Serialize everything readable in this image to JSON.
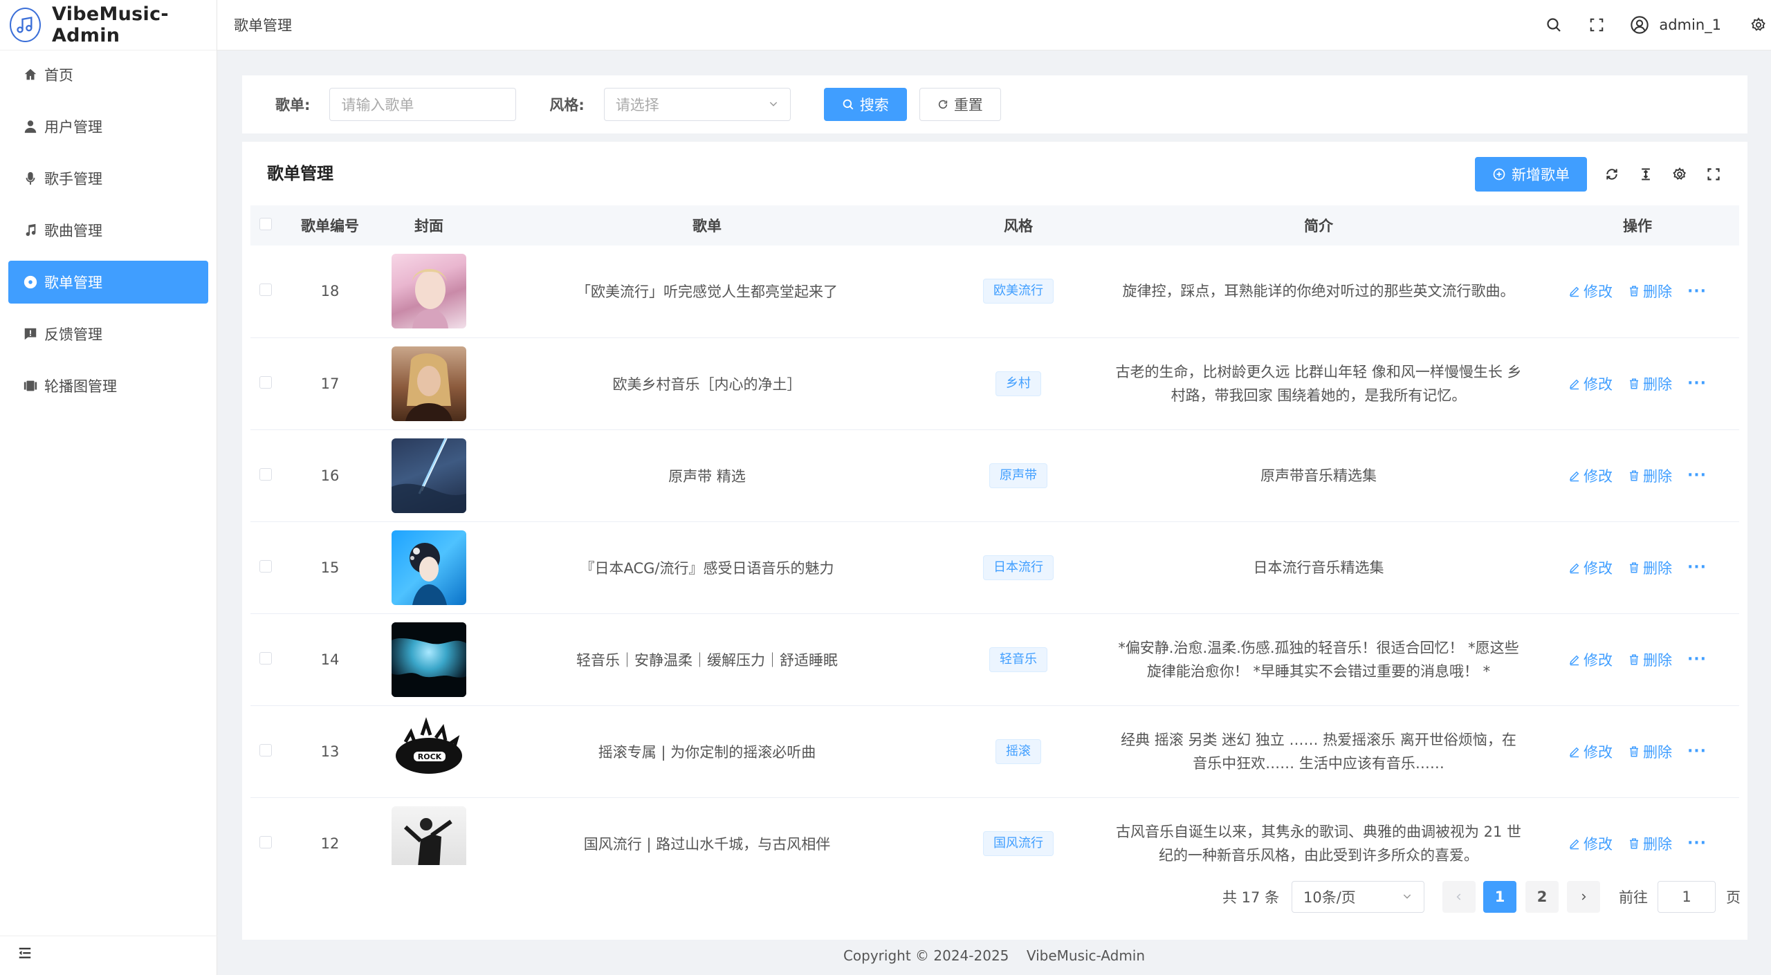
{
  "app": {
    "title": "VibeMusic-Admin"
  },
  "sidebar": {
    "items": [
      {
        "label": "首页",
        "icon": "home-icon"
      },
      {
        "label": "用户管理",
        "icon": "user-icon"
      },
      {
        "label": "歌手管理",
        "icon": "microphone-icon"
      },
      {
        "label": "歌曲管理",
        "icon": "music-note-icon"
      },
      {
        "label": "歌单管理",
        "icon": "disc-icon",
        "active": true
      },
      {
        "label": "反馈管理",
        "icon": "feedback-icon"
      },
      {
        "label": "轮播图管理",
        "icon": "carousel-icon"
      }
    ]
  },
  "header": {
    "breadcrumb": "歌单管理",
    "username": "admin_1"
  },
  "search": {
    "playlist_label": "歌单:",
    "playlist_placeholder": "请输入歌单",
    "style_label": "风格:",
    "style_placeholder": "请选择",
    "search_btn": "搜索",
    "reset_btn": "重置"
  },
  "card": {
    "title": "歌单管理",
    "add_btn": "新增歌单"
  },
  "table": {
    "columns": [
      "歌单编号",
      "封面",
      "歌单",
      "风格",
      "简介",
      "操作"
    ],
    "edit_label": "修改",
    "delete_label": "删除",
    "more_label": "···",
    "rows": [
      {
        "id": "18",
        "name": "「欧美流行」听完感觉人生都亮堂起来了",
        "style": "欧美流行",
        "intro": "旋律控，踩点，耳熟能详的你绝对听过的那些英文流行歌曲。"
      },
      {
        "id": "17",
        "name": "欧美乡村音乐［内心的净土］",
        "style": "乡村",
        "intro": "古老的生命，比树龄更久远 比群山年轻 像和风一样慢慢生长 乡村路，带我回家 围绕着她的，是我所有记忆。"
      },
      {
        "id": "16",
        "name": "原声带 精选",
        "style": "原声带",
        "intro": "原声带音乐精选集"
      },
      {
        "id": "15",
        "name": "『日本ACG/流行』感受日语音乐的魅力",
        "style": "日本流行",
        "intro": "日本流行音乐精选集"
      },
      {
        "id": "14",
        "name": "轻音乐｜安静温柔｜缓解压力｜舒适睡眠",
        "style": "轻音乐",
        "intro": "*偏安静.治愈.温柔.伤感.孤独的轻音乐！很适合回忆！ *愿这些旋律能治愈你！ *早睡其实不会错过重要的消息哦！ *"
      },
      {
        "id": "13",
        "name": "摇滚专属 | 为你定制的摇滚必听曲",
        "style": "摇滚",
        "intro": "经典 摇滚 另类 迷幻 独立 …… 热爱摇滚乐 离开世俗烦恼，在音乐中狂欢…… 生活中应该有音乐……"
      },
      {
        "id": "12",
        "name": "国风流行 | 路过山水千城，与古风相伴",
        "style": "国风流行",
        "intro": "古风音乐自诞生以来，其隽永的歌词、典雅的曲调被视为 21 世纪的一种新音乐风格，由此受到许多所众的喜爱。"
      }
    ]
  },
  "pagination": {
    "total": "共 17 条",
    "page_size": "10条/页",
    "pages": [
      "1",
      "2"
    ],
    "current": "1",
    "goto_label": "前往",
    "goto_value": "1",
    "page_label": "页"
  },
  "footer": {
    "text": "Copyright © 2024-2025    VibeMusic-Admin"
  },
  "colors": {
    "primary": "#409eff",
    "tag_bg": "#ecf5ff"
  }
}
